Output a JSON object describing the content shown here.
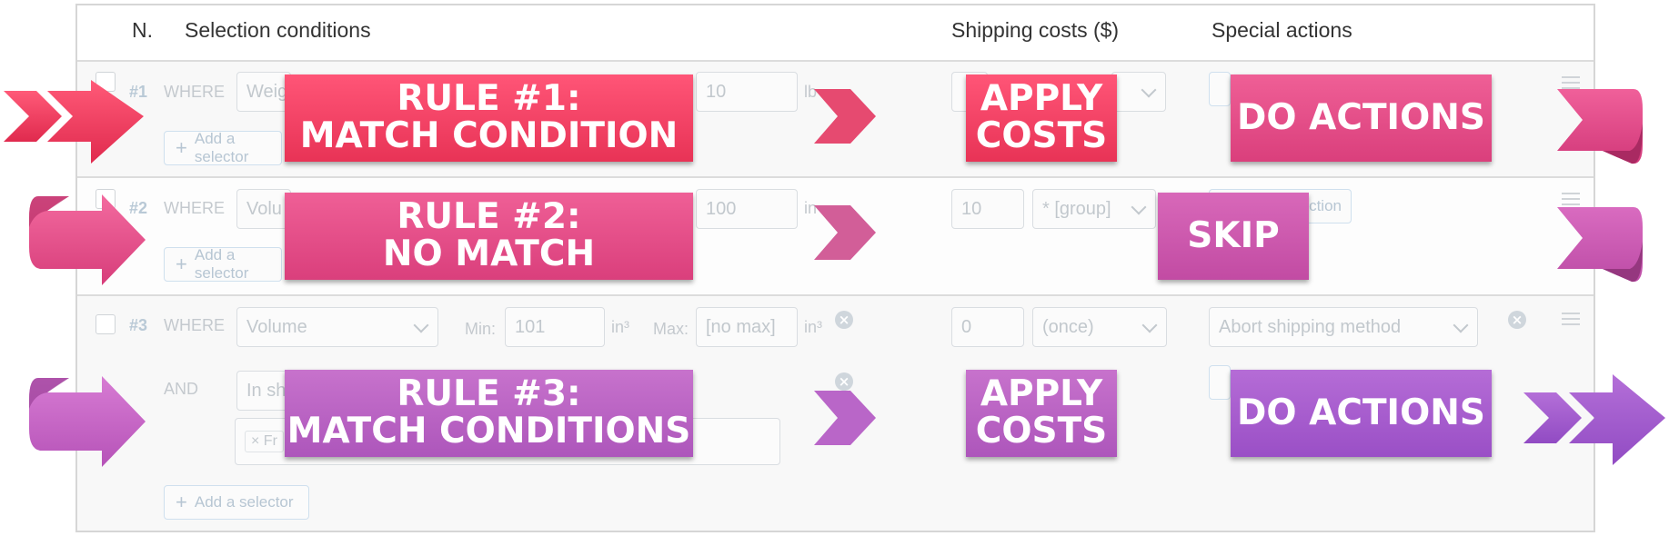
{
  "header": {
    "col_num": "N.",
    "col_conditions": "Selection conditions",
    "col_costs": "Shipping costs ($)",
    "col_actions": "Special actions"
  },
  "rows": [
    {
      "num": "#1",
      "where": "WHERE",
      "selector": "Weig",
      "max_value": "10",
      "unit": "lb",
      "add_selector": "Add a selector"
    },
    {
      "num": "#2",
      "where": "WHERE",
      "selector": "Volu",
      "max_value": "100",
      "unit": "in",
      "cost": "10",
      "cost_mode": "* [group]",
      "add_selector": "Add a selector",
      "add_action": "action"
    },
    {
      "num": "#3",
      "where": "WHERE",
      "selector": "Volume",
      "min_label": "Min:",
      "min_value": "101",
      "unit": "in³",
      "max_label": "Max:",
      "max_placeholder": "[no max]",
      "unit2": "in³",
      "cost": "0",
      "cost_mode": "(once)",
      "action": "Abort shipping method",
      "and": "AND",
      "selector2": "In sh",
      "tag": "× Fr",
      "add_selector": "Add a selector"
    }
  ],
  "banners": {
    "rule1_line1": "RULE #1:",
    "rule1_line2": "MATCH CONDITION",
    "rule2_line1": "RULE #2:",
    "rule2_line2": "NO MATCH",
    "rule3_line1": "RULE #3:",
    "rule3_line2": "MATCH CONDITIONS",
    "apply1_line1": "APPLY",
    "apply1_line2": "COSTS",
    "apply3_line1": "APPLY",
    "apply3_line2": "COSTS",
    "do1": "DO ACTIONS",
    "skip": "SKIP",
    "do3": "DO ACTIONS"
  },
  "colors": {
    "rule1": "#f0365a",
    "rule2": "#e5478a",
    "rule3": "#bb5cbf",
    "do3": "#a259cd",
    "skip": "#cf58ae"
  }
}
